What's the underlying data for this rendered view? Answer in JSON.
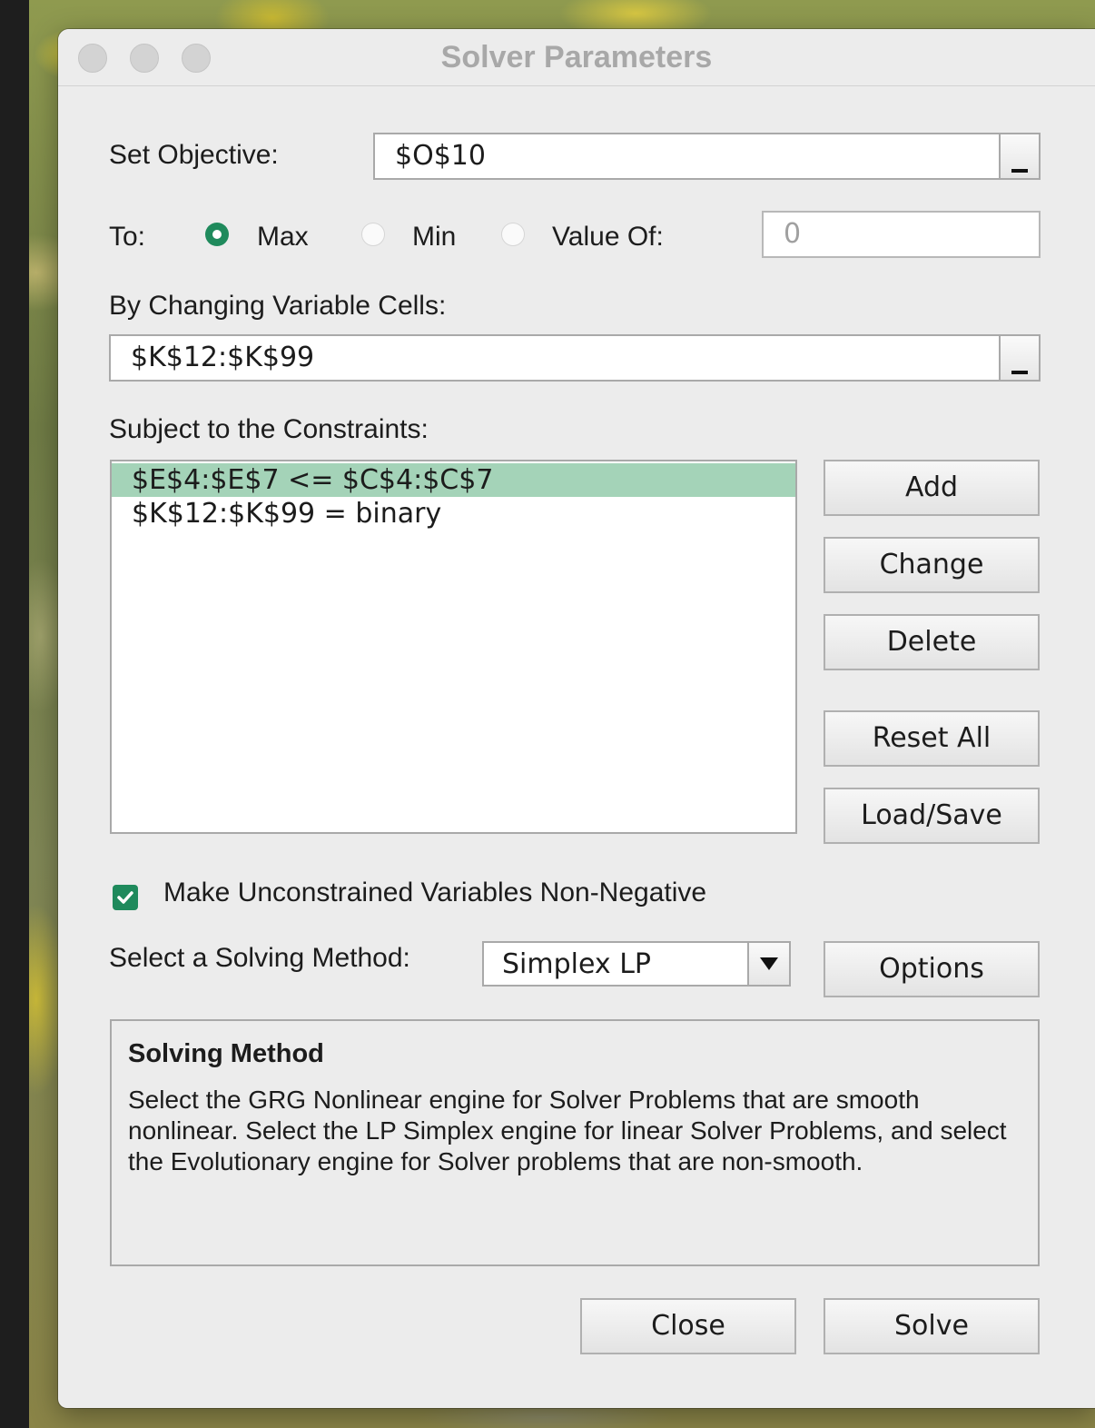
{
  "window": {
    "title": "Solver Parameters"
  },
  "objective": {
    "label": "Set Objective:",
    "value": "$O$10"
  },
  "to": {
    "label": "To:",
    "options": [
      {
        "label": "Max",
        "selected": true
      },
      {
        "label": "Min",
        "selected": false
      },
      {
        "label": "Value Of:",
        "selected": false
      }
    ],
    "value_of": "0"
  },
  "variable_cells": {
    "label": "By Changing Variable Cells:",
    "value": "$K$12:$K$99"
  },
  "constraints": {
    "label": "Subject to the Constraints:",
    "items": [
      {
        "text": "$E$4:$E$7 <= $C$4:$C$7",
        "selected": true
      },
      {
        "text": "$K$12:$K$99 = binary",
        "selected": false
      }
    ],
    "buttons": {
      "add": "Add",
      "change": "Change",
      "delete": "Delete",
      "reset_all": "Reset All",
      "load_save": "Load/Save"
    }
  },
  "non_negative": {
    "label": "Make Unconstrained Variables Non-Negative",
    "checked": true
  },
  "solving_method": {
    "label": "Select a Solving Method:",
    "selected": "Simplex LP",
    "options_button": "Options"
  },
  "method_info": {
    "title": "Solving Method",
    "description": "Select the GRG Nonlinear engine for Solver Problems that are smooth nonlinear. Select the LP Simplex engine for linear Solver Problems, and select the Evolutionary engine for Solver problems that are non-smooth."
  },
  "footer": {
    "close": "Close",
    "solve": "Solve"
  },
  "colors": {
    "accent": "#1f8a5c",
    "selection": "#a4d3b8",
    "window_bg": "#ececec"
  }
}
